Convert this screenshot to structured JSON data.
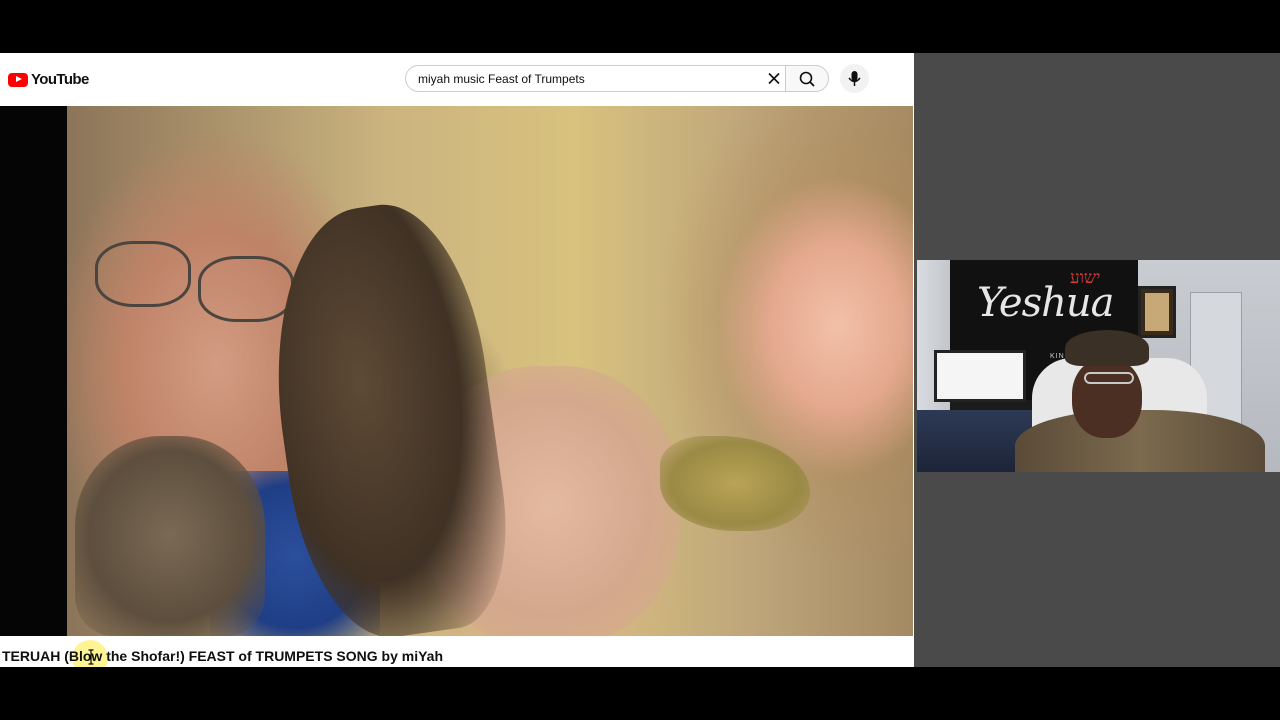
{
  "youtube": {
    "logo_text": "YouTube",
    "search": {
      "value": "miyah music Feast of Trumpets"
    },
    "video": {
      "title": "TERUAH (Blow the Shofar!) FEAST of TRUMPETS SONG by miYah"
    }
  },
  "webcam": {
    "banner_word": "Yeshua",
    "banner_hebrew": "ישוע",
    "banner_sub": "KINGS · LORD"
  },
  "colors": {
    "youtube_red": "#ff0000",
    "right_panel_bg": "#4a4a4a",
    "letterbox": "#000000",
    "cursor_highlight": "#ffeb3c"
  },
  "icons": [
    "youtube-logo-icon",
    "clear-icon",
    "search-icon",
    "mic-icon",
    "text-cursor-icon"
  ]
}
